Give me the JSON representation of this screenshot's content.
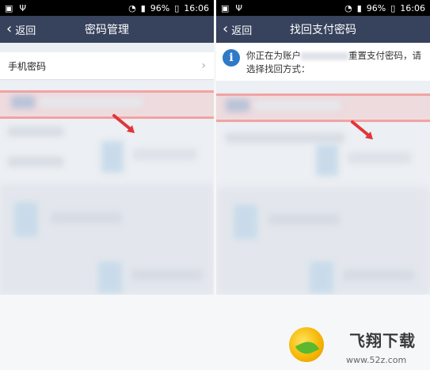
{
  "status_bar": {
    "battery": "96%",
    "time": "16:06"
  },
  "left_screen": {
    "back_label": "返回",
    "title": "密码管理",
    "items": [
      {
        "label": "手机密码"
      }
    ]
  },
  "right_screen": {
    "back_label": "返回",
    "title": "找回支付密码",
    "info_prefix": "你正在为账户",
    "info_suffix": "重置支付密码，请选择找回方式："
  },
  "watermark": {
    "brand": "飞翔下载",
    "url": "www.52z.com"
  },
  "colors": {
    "navbar": "#37425c",
    "highlight": "#f2a3a3",
    "info_icon": "#2f79c7"
  }
}
